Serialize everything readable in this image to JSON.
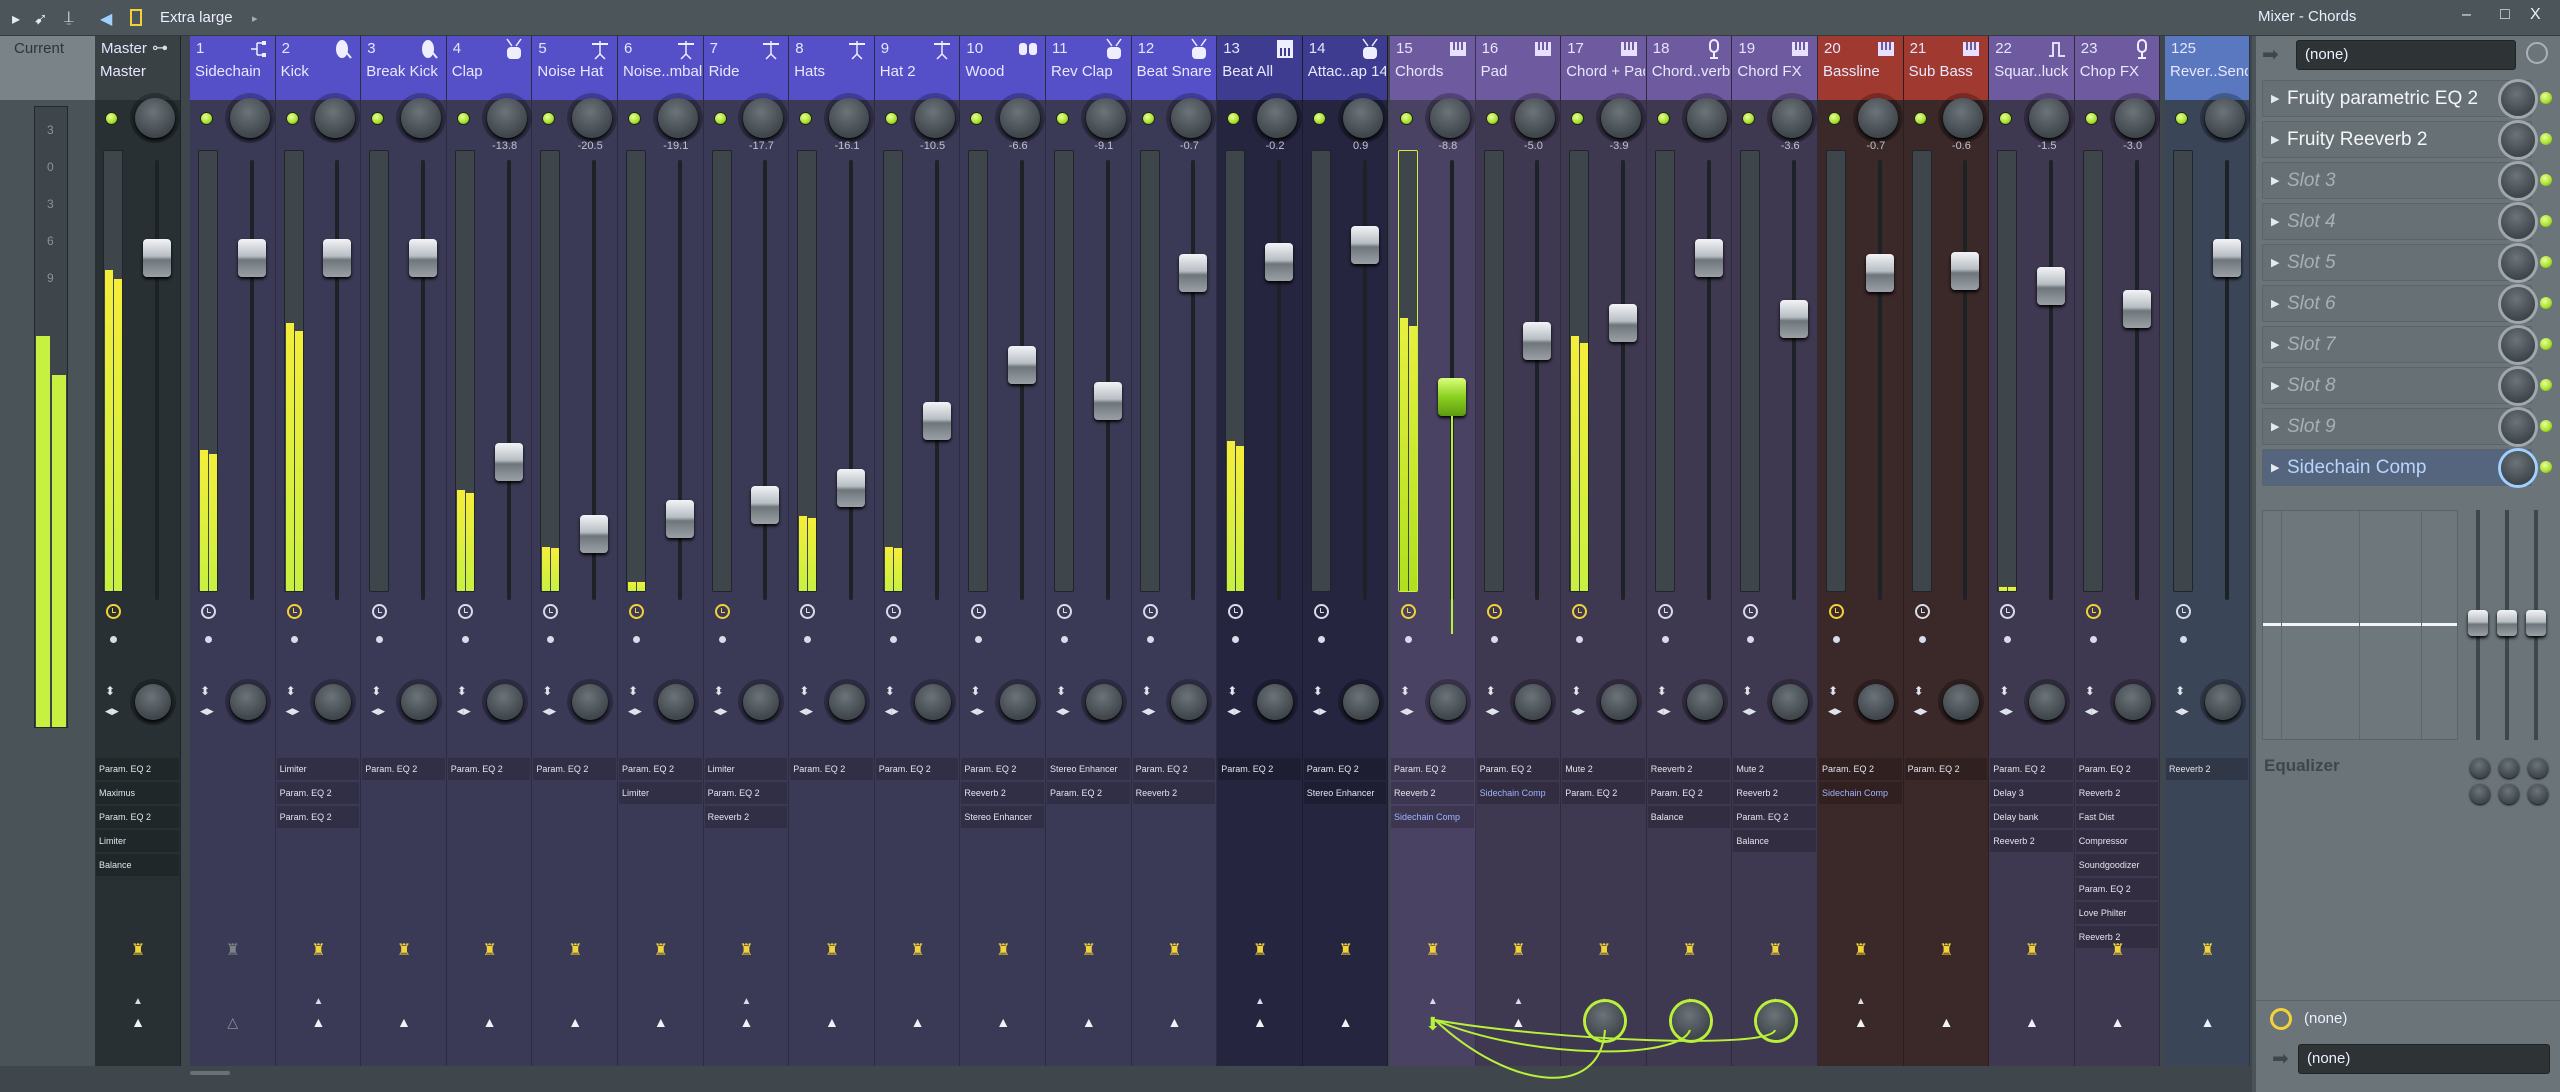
{
  "toolbar": {
    "icons": [
      "play-arrow-icon",
      "bird-icon",
      "stand-icon",
      "speaker-icon",
      "layout-icon"
    ],
    "mode": "Extra large",
    "window_title": "Mixer - Chords",
    "minimize": "‒",
    "maximize": "□",
    "close": "X"
  },
  "current": {
    "label": "Current",
    "scale": [
      "3",
      "0",
      "3",
      "6",
      "9"
    ],
    "level": 0.63
  },
  "colors": {
    "blue_hdr": "#5650c8",
    "blue_body": "#3b3a56",
    "navy_hdr": "#3e3c90",
    "navy_body": "#25253f",
    "purple_hdr": "#6e5a9e",
    "purple_body": "#3e3850",
    "red_hdr": "#a03a30",
    "red_body": "#3b2828",
    "send_hdr": "#5a78c0",
    "send_body": "#3b4558",
    "master_hdr": "#3a4145",
    "master_body": "#283033",
    "accent": "#b8f03a"
  },
  "master": {
    "num": "Master",
    "name": "Master",
    "level": 0.73,
    "volume_db": 0,
    "auto": true,
    "inserts": [
      "Param. EQ 2",
      "Maximus",
      "Param. EQ 2",
      "Limiter",
      "Balance"
    ]
  },
  "channels": [
    {
      "num": "1",
      "name": "Sidechain",
      "icon": "sidechain-icon",
      "group": "blue",
      "db": "",
      "volume_db": 0,
      "level": 0.32,
      "auto": false,
      "inserts": [],
      "route": false,
      "send": "outline"
    },
    {
      "num": "2",
      "name": "Kick",
      "icon": "kick-icon",
      "group": "blue",
      "db": "",
      "volume_db": 0,
      "level": 0.61,
      "auto": true,
      "inserts": [
        "Limiter",
        "Param. EQ 2",
        "Param. EQ 2"
      ],
      "route": true,
      "send": "up",
      "small": true
    },
    {
      "num": "3",
      "name": "Break Kick",
      "icon": "kick-icon",
      "group": "blue",
      "db": "",
      "volume_db": 0,
      "level": 0,
      "auto": false,
      "inserts": [
        "Param. EQ 2"
      ],
      "route": true,
      "send": "up"
    },
    {
      "num": "4",
      "name": "Clap",
      "icon": "drum-icon",
      "group": "blue",
      "db": "-13.8",
      "volume_db": -13.8,
      "level": 0.23,
      "auto": false,
      "inserts": [
        "Param. EQ 2"
      ],
      "route": true,
      "send": "up"
    },
    {
      "num": "5",
      "name": "Noise Hat",
      "icon": "cymbal-icon",
      "group": "blue",
      "db": "-20.5",
      "volume_db": -20.5,
      "level": 0.1,
      "auto": false,
      "inserts": [
        "Param. EQ 2"
      ],
      "route": true,
      "send": "up"
    },
    {
      "num": "6",
      "name": "Noise..mbal",
      "icon": "cymbal-icon",
      "group": "blue",
      "db": "-19.1",
      "volume_db": -19.1,
      "level": 0.02,
      "auto": true,
      "inserts": [
        "Param. EQ 2",
        "Limiter"
      ],
      "route": true,
      "send": "up"
    },
    {
      "num": "7",
      "name": "Ride",
      "icon": "cymbal-icon",
      "group": "blue",
      "db": "-17.7",
      "volume_db": -17.7,
      "level": 0,
      "auto": true,
      "inserts": [
        "Limiter",
        "Param. EQ 2",
        "Reeverb 2"
      ],
      "route": true,
      "send": "up",
      "small": true
    },
    {
      "num": "8",
      "name": "Hats",
      "icon": "cymbal-icon",
      "group": "blue",
      "db": "-16.1",
      "volume_db": -16.1,
      "level": 0.17,
      "auto": false,
      "inserts": [
        "Param. EQ 2"
      ],
      "route": true,
      "send": "up"
    },
    {
      "num": "9",
      "name": "Hat 2",
      "icon": "cymbal-icon",
      "group": "blue",
      "db": "-10.5",
      "volume_db": -10.5,
      "level": 0.1,
      "auto": false,
      "inserts": [
        "Param. EQ 2"
      ],
      "route": true,
      "send": "up"
    },
    {
      "num": "10",
      "name": "Wood",
      "icon": "bongo-icon",
      "group": "blue",
      "db": "-6.6",
      "volume_db": -6.6,
      "level": 0,
      "auto": false,
      "inserts": [
        "Param. EQ 2",
        "Reeverb 2",
        "Stereo Enhancer"
      ],
      "route": true,
      "send": "up"
    },
    {
      "num": "11",
      "name": "Rev Clap",
      "icon": "drum-icon",
      "group": "blue",
      "db": "-9.1",
      "volume_db": -9.1,
      "level": 0,
      "auto": false,
      "inserts": [
        "Stereo Enhancer",
        "Param. EQ 2"
      ],
      "route": true,
      "send": "up"
    },
    {
      "num": "12",
      "name": "Beat Snare",
      "icon": "drum-icon",
      "group": "blue",
      "db": "-0.7",
      "volume_db": -0.7,
      "level": 0,
      "auto": false,
      "inserts": [
        "Param. EQ 2",
        "Reeverb 2"
      ],
      "route": true,
      "send": "up"
    },
    {
      "num": "13",
      "name": "Beat All",
      "icon": "drum-machine-icon",
      "group": "navy",
      "db": "-0.2",
      "volume_db": -0.2,
      "level": 0.34,
      "auto": false,
      "inserts": [
        "Param. EQ 2"
      ],
      "route": true,
      "send": "up",
      "small": true
    },
    {
      "num": "14",
      "name": "Attac..ap 14",
      "icon": "drum-icon",
      "group": "navy",
      "db": "0.9",
      "volume_db": 0.9,
      "level": 0,
      "auto": false,
      "inserts": [
        "Param. EQ 2",
        "Stereo Enhancer"
      ],
      "route": true,
      "send": "up"
    },
    {
      "num": "15",
      "name": "Chords",
      "icon": "piano-icon",
      "group": "purple",
      "db": "-8.8",
      "volume_db": -8.8,
      "level": 0.62,
      "auto": true,
      "selected": true,
      "inserts": [
        "Param. EQ 2",
        "Reeverb 2",
        "Sidechain Comp"
      ],
      "route": true,
      "send": "down",
      "small": true
    },
    {
      "num": "16",
      "name": "Pad",
      "icon": "piano-icon",
      "group": "purple",
      "db": "-5.0",
      "volume_db": -5.0,
      "level": 0,
      "auto": true,
      "inserts": [
        "Param. EQ 2",
        "Sidechain Comp"
      ],
      "route": true,
      "send": "up",
      "small": true
    },
    {
      "num": "17",
      "name": "Chord + Pad",
      "icon": "piano-icon",
      "group": "purple",
      "db": "-3.9",
      "volume_db": -3.9,
      "level": 0.58,
      "auto": true,
      "inserts": [
        "Mute 2",
        "Param. EQ 2"
      ],
      "route": true,
      "send": "knob",
      "small": true
    },
    {
      "num": "18",
      "name": "Chord..verb",
      "icon": "mic-icon",
      "group": "purple",
      "db": "",
      "volume_db": 0,
      "level": 0,
      "auto": false,
      "inserts": [
        "Reeverb 2",
        "Param. EQ 2",
        "Balance"
      ],
      "route": true,
      "send": "knob",
      "small": true
    },
    {
      "num": "19",
      "name": "Chord FX",
      "icon": "piano-icon",
      "group": "purple",
      "db": "-3.6",
      "volume_db": -3.6,
      "level": 0,
      "auto": false,
      "inserts": [
        "Mute 2",
        "Reeverb 2",
        "Param. EQ 2",
        "Balance"
      ],
      "route": true,
      "send": "knob",
      "small": true
    },
    {
      "num": "20",
      "name": "Bassline",
      "icon": "piano-icon",
      "group": "red",
      "db": "-0.7",
      "volume_db": -0.7,
      "level": 0,
      "auto": true,
      "inserts": [
        "Param. EQ 2",
        "Sidechain Comp"
      ],
      "route": true,
      "send": "up",
      "small": true
    },
    {
      "num": "21",
      "name": "Sub Bass",
      "icon": "piano-icon",
      "group": "red",
      "db": "-0.6",
      "volume_db": -0.6,
      "level": 0,
      "auto": false,
      "inserts": [
        "Param. EQ 2"
      ],
      "route": true,
      "send": "up"
    },
    {
      "num": "22",
      "name": "Squar..luck",
      "icon": "pulse-icon",
      "group": "purple",
      "db": "-1.5",
      "volume_db": -1.5,
      "level": 0.01,
      "auto": false,
      "inserts": [
        "Param. EQ 2",
        "Delay 3",
        "Delay bank",
        "Reeverb 2"
      ],
      "route": true,
      "send": "up"
    },
    {
      "num": "23",
      "name": "Chop FX",
      "icon": "mic-icon",
      "group": "purple",
      "db": "-3.0",
      "volume_db": -3.0,
      "level": 0,
      "auto": true,
      "inserts": [
        "Param. EQ 2",
        "Reeverb 2",
        "Fast Dist",
        "Compressor",
        "Soundgoodizer",
        "Param. EQ 2",
        "Love Philter",
        "Reeverb 2"
      ],
      "route": true,
      "send": "up"
    },
    {
      "num": "125",
      "name": "Rever..Send",
      "icon": "",
      "group": "send",
      "db": "",
      "volume_db": 0,
      "level": 0,
      "auto": false,
      "inserts": [
        "Reeverb 2"
      ],
      "route": true,
      "send": "up"
    }
  ],
  "panel": {
    "input": "(none)",
    "slots": [
      {
        "label": "Fruity parametric EQ 2",
        "empty": false
      },
      {
        "label": "Fruity Reeverb 2",
        "empty": false
      },
      {
        "label": "Slot 3",
        "empty": true
      },
      {
        "label": "Slot 4",
        "empty": true
      },
      {
        "label": "Slot 5",
        "empty": true
      },
      {
        "label": "Slot 6",
        "empty": true
      },
      {
        "label": "Slot 7",
        "empty": true
      },
      {
        "label": "Slot 8",
        "empty": true
      },
      {
        "label": "Slot 9",
        "empty": true
      },
      {
        "label": "Sidechain Comp",
        "empty": false,
        "selected": true
      }
    ],
    "eq_label": "Equalizer",
    "eq_bands_db": [
      0,
      0,
      0
    ],
    "latency": "(none)",
    "output": "(none)"
  }
}
